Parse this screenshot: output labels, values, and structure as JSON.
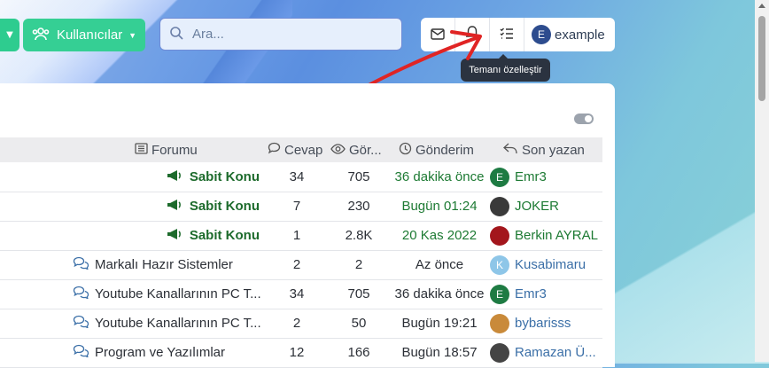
{
  "topbar": {
    "users_label": "Kullanıcılar",
    "search_placeholder": "Ara...",
    "username": "example",
    "avatar_letter": "E",
    "tooltip": "Temanı özelleştir",
    "icons": [
      "envelope-icon",
      "bell-icon",
      "checklist-icon"
    ]
  },
  "table": {
    "headers": {
      "forum": "Forumu",
      "replies": "Cevap",
      "views": "Gör...",
      "posted": "Gönderim",
      "last_poster": "Son yazan"
    },
    "rows": [
      {
        "title": "Sabit Konu",
        "sticky": true,
        "replies": "34",
        "views": "705",
        "time": "36 dakika önce",
        "user": "Emr3",
        "avatar_letter": "E",
        "avatar_color": "#1e7b43"
      },
      {
        "title": "Sabit Konu",
        "sticky": true,
        "replies": "7",
        "views": "230",
        "time": "Bugün 01:24",
        "user": "JOKER",
        "avatar_letter": "",
        "avatar_color": "#3a3a3a"
      },
      {
        "title": "Sabit Konu",
        "sticky": true,
        "replies": "1",
        "views": "2.8K",
        "time": "20 Kas 2022",
        "user": "Berkin AYRAL",
        "avatar_letter": "",
        "avatar_color": "#a3161c"
      },
      {
        "title": "Markalı Hazır Sistemler",
        "sticky": false,
        "replies": "2",
        "views": "2",
        "time": "Az önce",
        "user": "Kusabimaru",
        "avatar_letter": "K",
        "avatar_color": "#8ec6e8"
      },
      {
        "title": "Youtube Kanallarının PC T...",
        "sticky": false,
        "replies": "34",
        "views": "705",
        "time": "36 dakika önce",
        "user": "Emr3",
        "avatar_letter": "E",
        "avatar_color": "#1e7b43"
      },
      {
        "title": "Youtube Kanallarının PC T...",
        "sticky": false,
        "replies": "2",
        "views": "50",
        "time": "Bugün 19:21",
        "user": "bybarisss",
        "avatar_letter": "",
        "avatar_color": "#c98a3a"
      },
      {
        "title": "Program ve Yazılımlar",
        "sticky": false,
        "replies": "12",
        "views": "166",
        "time": "Bugün 18:57",
        "user": "Ramazan Ü...",
        "avatar_letter": "",
        "avatar_color": "#444"
      }
    ]
  }
}
